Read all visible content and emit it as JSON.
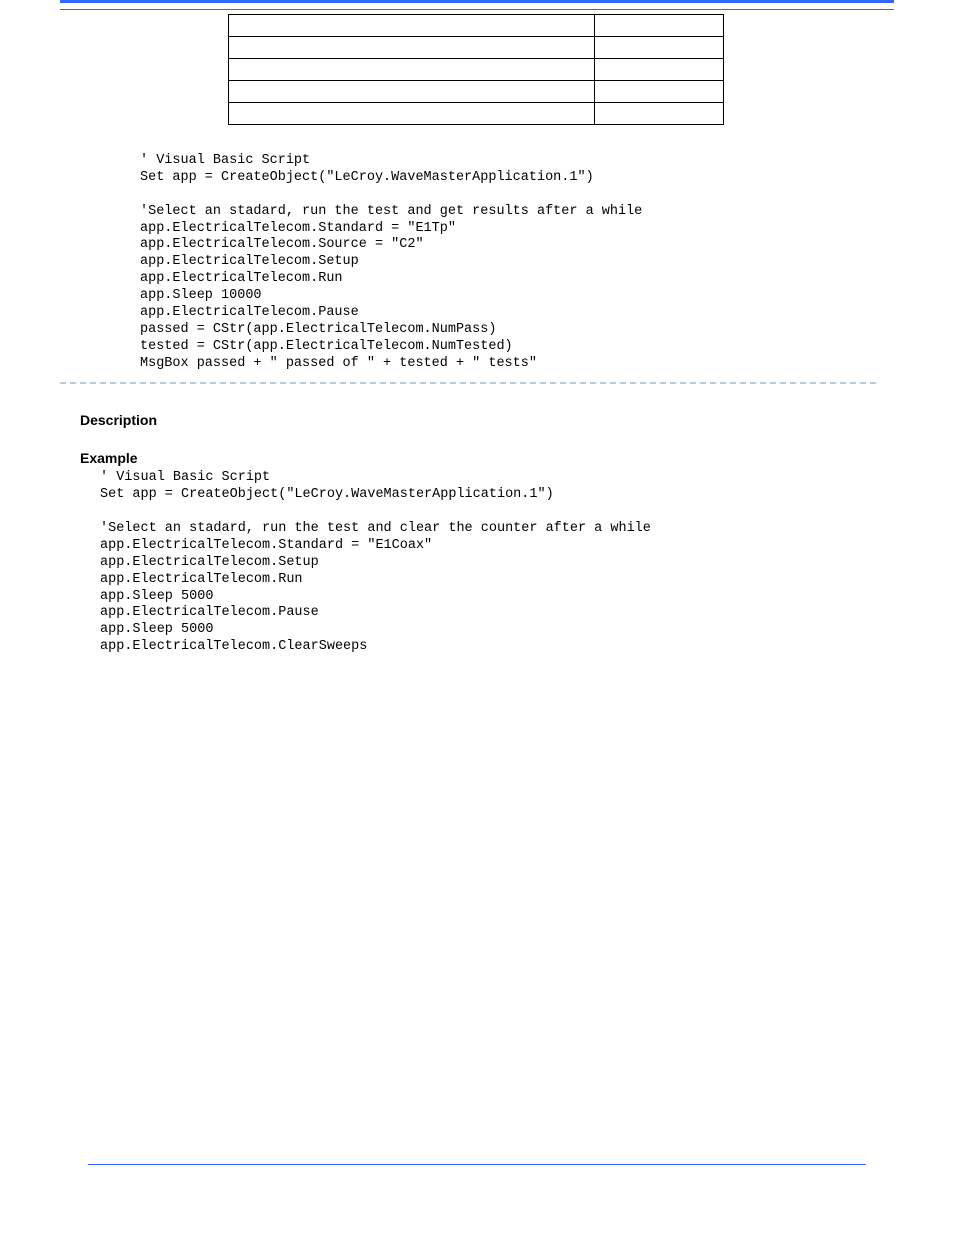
{
  "table": {
    "rows": [
      {
        "c1": "",
        "c2": ""
      },
      {
        "c1": "",
        "c2": ""
      },
      {
        "c1": "",
        "c2": ""
      },
      {
        "c1": "",
        "c2": ""
      },
      {
        "c1": "",
        "c2": ""
      }
    ]
  },
  "code1": "' Visual Basic Script\nSet app = CreateObject(\"LeCroy.WaveMasterApplication.1\")\n\n'Select an stadard, run the test and get results after a while\napp.ElectricalTelecom.Standard = \"E1Tp\"\napp.ElectricalTelecom.Source = \"C2\"\napp.ElectricalTelecom.Setup\napp.ElectricalTelecom.Run\napp.Sleep 10000\napp.ElectricalTelecom.Pause\npassed = CStr(app.ElectricalTelecom.NumPass)\ntested = CStr(app.ElectricalTelecom.NumTested)\nMsgBox passed + \" passed of \" + tested + \" tests\"",
  "headings": {
    "description": "Description",
    "example": "Example"
  },
  "code2": "' Visual Basic Script\nSet app = CreateObject(\"LeCroy.WaveMasterApplication.1\")\n\n'Select an stadard, run the test and clear the counter after a while\napp.ElectricalTelecom.Standard = \"E1Coax\"\napp.ElectricalTelecom.Setup\napp.ElectricalTelecom.Run\napp.Sleep 5000\napp.ElectricalTelecom.Pause\napp.Sleep 5000\napp.ElectricalTelecom.ClearSweeps"
}
